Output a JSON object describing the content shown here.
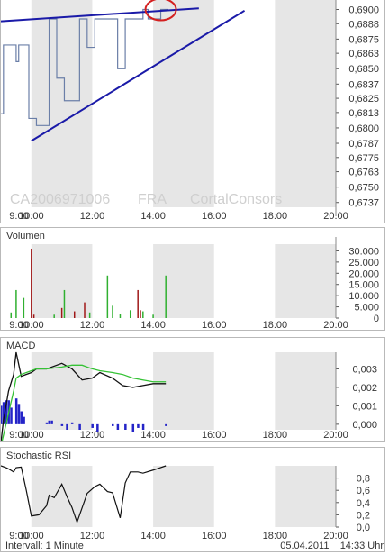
{
  "watermark": {
    "isin": "CA2006971006",
    "exchange": "FRA",
    "brand": "CortalConsors"
  },
  "footer": {
    "interval": "Intervall: 1 Minute",
    "date": "05.04.2011",
    "time": "14:33 Uhr"
  },
  "colors": {
    "price_line": "#6b7fa8",
    "trend_line": "#1a1aa8",
    "annotation_circle": "#d42020",
    "vol_up": "#30b030",
    "vol_down": "#a01818",
    "macd_line": "#111111",
    "signal_line": "#35c235",
    "macd_hist": "#2424c8",
    "rsi_line": "#111111",
    "shade": "#e6e6e6"
  },
  "chart_data": [
    {
      "type": "line",
      "x": [
        "09:00",
        "09:05",
        "09:15",
        "09:25",
        "09:30",
        "09:35",
        "09:40",
        "09:55",
        "10:00",
        "10:05",
        "10:10",
        "10:25",
        "10:35",
        "10:45",
        "10:50",
        "11:00",
        "11:05",
        "11:15",
        "11:20",
        "11:35",
        "11:40",
        "11:50",
        "11:55",
        "12:05",
        "12:10",
        "12:20",
        "12:30",
        "12:45",
        "12:50",
        "13:00",
        "13:05",
        "13:15",
        "13:20",
        "13:35",
        "13:40",
        "13:50",
        "14:00",
        "14:10",
        "14:15",
        "14:30"
      ],
      "series": [
        {
          "values": [
            0.6812,
            0.687,
            0.687,
            0.687,
            0.6856,
            0.687,
            0.687,
            0.6808,
            0.6808,
            0.6808,
            0.6802,
            0.6802,
            0.6892,
            0.6892,
            0.6842,
            0.6842,
            0.6823,
            0.6823,
            0.6823,
            0.6892,
            0.6892,
            0.6868,
            0.6868,
            0.6892,
            0.6892,
            0.6892,
            0.6892,
            0.6892,
            0.685,
            0.685,
            0.6892,
            0.6892,
            0.6892,
            0.6892,
            0.69,
            0.6892,
            0.6892,
            0.6892,
            0.69,
            0.69
          ]
        }
      ],
      "xlim": [
        "09:00",
        "20:00"
      ],
      "xticks": [
        "9:00",
        "10:00",
        "12:00",
        "14:00",
        "16:00",
        "18:00",
        "20:00"
      ],
      "ylim": [
        0.6733,
        0.6908
      ],
      "yticks": [
        "0,6900",
        "0,6888",
        "0,6875",
        "0,6863",
        "0,6850",
        "0,6837",
        "0,6825",
        "0,6813",
        "0,6800",
        "0,6787",
        "0,6775",
        "0,6763",
        "0,6750",
        "0,6737"
      ],
      "trendlines": [
        {
          "from": [
            "09:00",
            0.689
          ],
          "to": [
            "15:30",
            0.6901
          ]
        },
        {
          "from": [
            "10:00",
            0.6789
          ],
          "to": [
            "17:00",
            0.6899
          ]
        }
      ],
      "annotation": {
        "type": "ellipse",
        "center": [
          "14:15",
          0.69
        ]
      }
    },
    {
      "type": "bar",
      "title": "Volumen",
      "bars": [
        {
          "x": "09:20",
          "v": 2500,
          "dir": "up"
        },
        {
          "x": "09:30",
          "v": 12500,
          "dir": "up"
        },
        {
          "x": "09:45",
          "v": 9000,
          "dir": "up"
        },
        {
          "x": "10:00",
          "v": 31000,
          "dir": "down"
        },
        {
          "x": "10:05",
          "v": 1500,
          "dir": "down"
        },
        {
          "x": "10:45",
          "v": 1500,
          "dir": "up"
        },
        {
          "x": "11:00",
          "v": 4500,
          "dir": "down"
        },
        {
          "x": "11:05",
          "v": 12500,
          "dir": "up"
        },
        {
          "x": "11:25",
          "v": 3000,
          "dir": "down"
        },
        {
          "x": "11:45",
          "v": 7000,
          "dir": "down"
        },
        {
          "x": "11:55",
          "v": 2500,
          "dir": "up"
        },
        {
          "x": "12:30",
          "v": 19000,
          "dir": "up"
        },
        {
          "x": "12:40",
          "v": 5500,
          "dir": "up"
        },
        {
          "x": "12:55",
          "v": 2000,
          "dir": "up"
        },
        {
          "x": "13:15",
          "v": 3500,
          "dir": "up"
        },
        {
          "x": "13:30",
          "v": 12500,
          "dir": "down"
        },
        {
          "x": "13:35",
          "v": 3500,
          "dir": "down"
        },
        {
          "x": "13:40",
          "v": 3000,
          "dir": "up"
        },
        {
          "x": "14:00",
          "v": 1500,
          "dir": "up"
        },
        {
          "x": "14:25",
          "v": 19000,
          "dir": "up"
        }
      ],
      "xlim": [
        "09:00",
        "20:00"
      ],
      "xticks": [
        "9:00",
        "10:00",
        "12:00",
        "14:00",
        "16:00",
        "18:00",
        "20:00"
      ],
      "ylim": [
        0,
        33000
      ],
      "yticks": [
        "30.000",
        "25.000",
        "20.000",
        "15.000",
        "10.000",
        "5.000",
        "0"
      ]
    },
    {
      "type": "line",
      "title": "MACD",
      "x": [
        "09:00",
        "09:05",
        "09:15",
        "09:25",
        "09:30",
        "09:40",
        "10:00",
        "10:10",
        "10:30",
        "11:00",
        "11:20",
        "11:40",
        "12:00",
        "12:15",
        "12:40",
        "13:00",
        "13:20",
        "13:40",
        "14:00",
        "14:25"
      ],
      "series": [
        {
          "values": [
            -0.001,
            0.0002,
            0.0018,
            0.0027,
            0.0039,
            0.0026,
            0.0028,
            0.003,
            0.003,
            0.0033,
            0.003,
            0.0024,
            0.0025,
            0.0028,
            0.0025,
            0.0021,
            0.002,
            0.0021,
            0.0022,
            0.0022
          ]
        },
        {
          "values": [
            -0.0012,
            -0.0006,
            0.0006,
            0.0018,
            0.0025,
            0.0027,
            0.0029,
            0.003,
            0.003,
            0.0031,
            0.0032,
            0.0032,
            0.003,
            0.0029,
            0.0028,
            0.0027,
            0.0025,
            0.0024,
            0.0023,
            0.0023
          ]
        }
      ],
      "histogram": [
        {
          "x": "09:00",
          "v": 0.001
        },
        {
          "x": "09:05",
          "v": 0.0012
        },
        {
          "x": "09:10",
          "v": 0.0013
        },
        {
          "x": "09:15",
          "v": 0.0013
        },
        {
          "x": "09:20",
          "v": 0.0009
        },
        {
          "x": "09:30",
          "v": 0.0014
        },
        {
          "x": "09:35",
          "v": 0.0011
        },
        {
          "x": "09:40",
          "v": 0.0007
        },
        {
          "x": "09:45",
          "v": 0.0004
        },
        {
          "x": "10:30",
          "v": 0.0001
        },
        {
          "x": "10:35",
          "v": 0.0002
        },
        {
          "x": "10:40",
          "v": 0.0002
        },
        {
          "x": "11:00",
          "v": -0.0001
        },
        {
          "x": "11:10",
          "v": -0.0003
        },
        {
          "x": "11:20",
          "v": 0.0001
        },
        {
          "x": "11:35",
          "v": -0.0003
        },
        {
          "x": "12:00",
          "v": -0.0002
        },
        {
          "x": "12:10",
          "v": -0.0004
        },
        {
          "x": "12:40",
          "v": -0.0001
        },
        {
          "x": "12:50",
          "v": -0.0003
        },
        {
          "x": "13:05",
          "v": -0.0003
        },
        {
          "x": "13:20",
          "v": -0.0004
        },
        {
          "x": "13:30",
          "v": -0.0002
        },
        {
          "x": "13:40",
          "v": -0.0003
        },
        {
          "x": "14:25",
          "v": -0.0001
        }
      ],
      "xlim": [
        "09:00",
        "20:00"
      ],
      "xticks": [
        "9:00",
        "10:00",
        "12:00",
        "14:00",
        "16:00",
        "18:00",
        "20:00"
      ],
      "ylim": [
        -0.0003,
        0.0039
      ],
      "yticks": [
        "0,003",
        "0,002",
        "0,001",
        "0,000"
      ]
    },
    {
      "type": "line",
      "title": "Stochastic RSI",
      "x": [
        "09:00",
        "09:10",
        "09:15",
        "09:25",
        "09:30",
        "09:40",
        "09:50",
        "10:00",
        "10:15",
        "10:30",
        "10:35",
        "10:45",
        "11:00",
        "11:10",
        "11:20",
        "11:30",
        "11:50",
        "12:05",
        "12:15",
        "12:30",
        "12:40",
        "12:55",
        "13:05",
        "13:15",
        "13:30",
        "13:40",
        "14:00",
        "14:25"
      ],
      "series": [
        {
          "values": [
            1.0,
            0.97,
            0.95,
            0.9,
            0.97,
            0.98,
            0.6,
            0.18,
            0.2,
            0.35,
            0.52,
            0.48,
            0.7,
            0.5,
            0.32,
            0.08,
            0.55,
            0.66,
            0.7,
            0.58,
            0.56,
            0.15,
            0.72,
            0.9,
            0.9,
            0.88,
            0.93,
            1.0
          ]
        }
      ],
      "xlim": [
        "09:00",
        "20:00"
      ],
      "xticks": [
        "9:00",
        "10:00",
        "12:00",
        "14:00",
        "16:00",
        "18:00",
        "20:00"
      ],
      "ylim": [
        0,
        1.0
      ],
      "yticks": [
        "0,8",
        "0,6",
        "0,4",
        "0,2",
        "0,0"
      ]
    }
  ]
}
